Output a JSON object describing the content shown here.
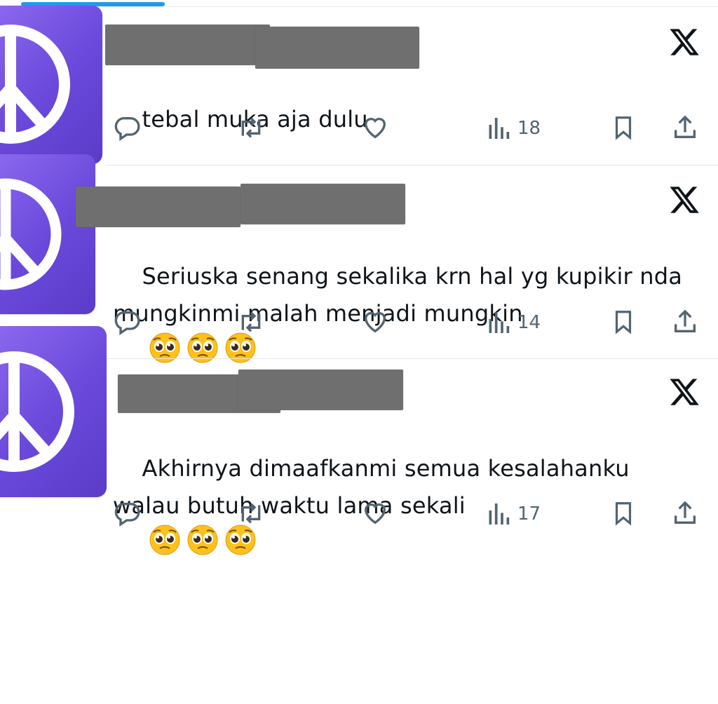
{
  "tweets": [
    {
      "text": "tebal muka aja dulu",
      "views": "18",
      "emojis": []
    },
    {
      "text": "Seriuska senang sekalika krn hal yg kupikir nda\nmungkinmi malah menjadi mungkin",
      "views": "14",
      "emojis": [
        "pleading-face",
        "pleading-face",
        "pleading-face"
      ]
    },
    {
      "text": "Akhirnya dimaafkanmi semua kesalahanku\nwalau butuh waktu lama sekali",
      "views": "17",
      "emojis": [
        "pleading-face",
        "pleading-face",
        "pleading-face"
      ]
    }
  ],
  "icons": {
    "avatar": "peace-icon",
    "platform": "x-logo-icon",
    "actions": [
      "reply-icon",
      "retweet-icon",
      "like-icon",
      "views-icon",
      "bookmark-icon",
      "share-icon"
    ]
  },
  "colors": {
    "avatar_start": "#8f6cf0",
    "avatar_end": "#5a3cc8",
    "action_gray": "#536471",
    "accent": "#1d9bf0",
    "redaction": "#6f6f6f"
  }
}
